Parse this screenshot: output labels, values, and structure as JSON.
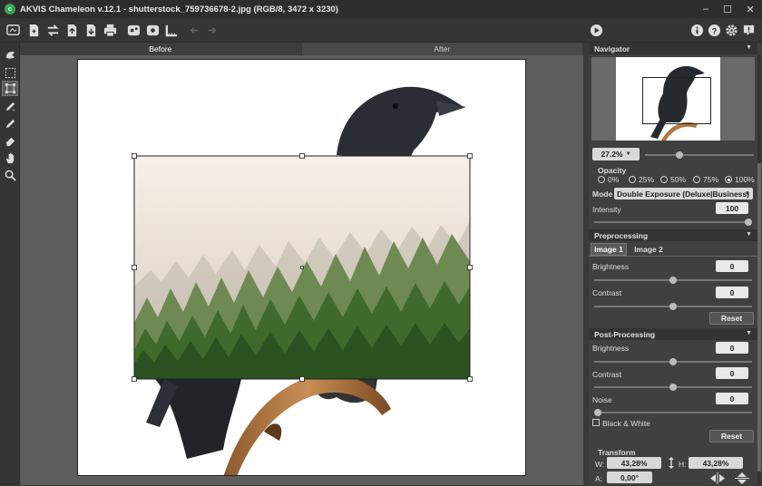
{
  "window": {
    "title": "AKVIS Chameleon v.12.1 - shutterstock_759736678-2.jpg (RGB/8, 3472 x 3230)",
    "app_icon": "akvis-chameleon-icon"
  },
  "tabs": {
    "before": "Before",
    "after": "After"
  },
  "navigator": {
    "header": "Navigator",
    "zoom": "27.2%",
    "zoom_level": 0.3
  },
  "opacity": {
    "label": "Opacity",
    "options": [
      "0%",
      "25%",
      "50%",
      "75%",
      "100%"
    ],
    "selected": "100%"
  },
  "mode": {
    "label": "Mode",
    "value": "Double Exposure (Deluxe|Business)"
  },
  "intensity": {
    "label": "Intensity",
    "value": "100",
    "level": 1.0
  },
  "preprocessing": {
    "header": "Preprocessing",
    "tabs": [
      "Image 1",
      "Image 2"
    ],
    "active_tab": "Image 1",
    "brightness": {
      "label": "Brightness",
      "value": "0",
      "level": 0.5
    },
    "contrast": {
      "label": "Contrast",
      "value": "0",
      "level": 0.5
    },
    "reset": "Reset"
  },
  "postprocessing": {
    "header": "Post-Processing",
    "brightness": {
      "label": "Brightness",
      "value": "0",
      "level": 0.5
    },
    "contrast": {
      "label": "Contrast",
      "value": "0",
      "level": 0.5
    },
    "noise": {
      "label": "Noise",
      "value": "0",
      "level": 0.0
    },
    "bw_label": "Black & White",
    "reset": "Reset"
  },
  "transform": {
    "header": "Transform",
    "w_label": "W:",
    "w_value": "43,28%",
    "h_label": "H:",
    "h_value": "43,28%",
    "a_label": "A:",
    "a_value": "0,00°"
  },
  "colors": {
    "accent": "#3aa655",
    "panel": "#404040",
    "header": "#333333"
  }
}
